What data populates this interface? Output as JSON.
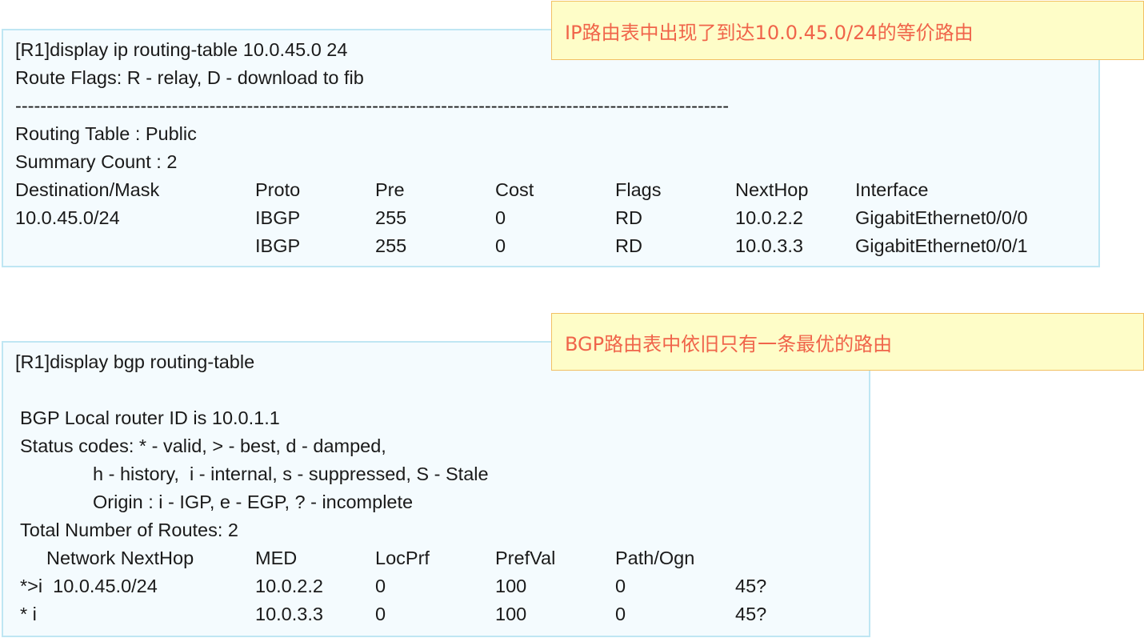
{
  "ip_table": {
    "command": "[R1]display ip routing-table 10.0.45.0 24",
    "flags_line": "Route Flags: R - relay, D - download to fib",
    "separator": "------------------------------------------------------------------------------------------------------------------",
    "table_name": "Routing Table : Public",
    "summary": "Summary Count : 2",
    "headers": [
      "Destination/Mask",
      "Proto",
      "Pre",
      "Cost",
      "Flags",
      "NextHop",
      "Interface"
    ],
    "rows": [
      [
        "10.0.45.0/24",
        "IBGP",
        "255",
        "0",
        "RD",
        "10.0.2.2",
        "GigabitEthernet0/0/0"
      ],
      [
        "",
        "IBGP",
        "255",
        "0",
        "RD",
        "10.0.3.3",
        "GigabitEthernet0/0/1"
      ]
    ]
  },
  "bgp_table": {
    "command": "[R1]display bgp routing-table",
    "router_id": "BGP Local router ID is 10.0.1.1",
    "status1": "Status codes: * - valid, > - best, d - damped,",
    "status2": "h - history,  i - internal, s - suppressed, S - Stale",
    "origin": "Origin : i - IGP, e - EGP, ? - incomplete",
    "total": "Total Number of Routes: 2",
    "headers": [
      "Network NextHop",
      "MED",
      "LocPrf",
      "PrefVal",
      "Path/Ogn"
    ],
    "rows": [
      [
        "*>i  10.0.45.0/24",
        "10.0.2.2",
        "0",
        "100",
        "0",
        "45?"
      ],
      [
        "* i",
        "10.0.3.3",
        "0",
        "100",
        "0",
        "45?"
      ]
    ]
  },
  "callouts": {
    "ip": "IP路由表中出现了到达10.0.45.0/24的等价路由",
    "bgp": "BGP路由表中依旧只有一条最优的路由"
  }
}
